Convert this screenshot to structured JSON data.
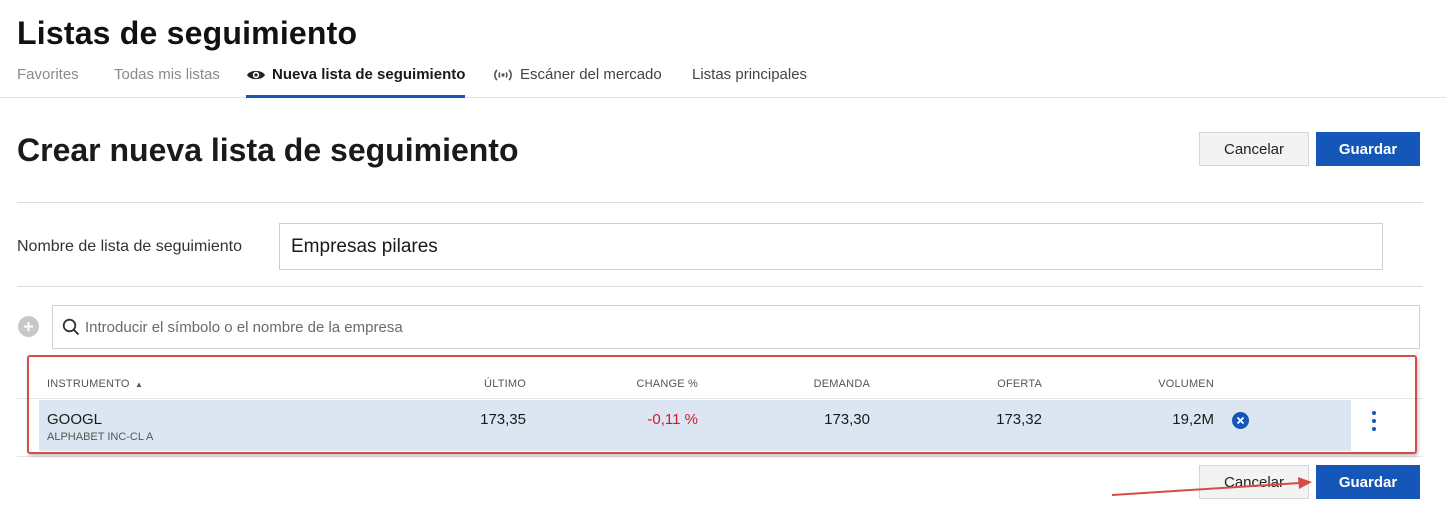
{
  "header": {
    "title": "Listas de seguimiento"
  },
  "tabs": [
    {
      "label": "Favorites"
    },
    {
      "label": "Todas mis listas"
    },
    {
      "label": "Nueva lista de seguimiento",
      "icon": "eye-icon"
    },
    {
      "label": "Escáner del mercado",
      "icon": "radar-icon"
    },
    {
      "label": "Listas principales"
    }
  ],
  "form": {
    "title": "Crear nueva lista de seguimiento",
    "cancel_label": "Cancelar",
    "save_label": "Guardar",
    "name_label": "Nombre de lista de seguimiento",
    "name_value": "Empresas pilares",
    "search_placeholder": "Introducir el símbolo o el nombre de la empresa"
  },
  "table": {
    "columns": [
      "INSTRUMENTO",
      "ÚLTIMO",
      "CHANGE %",
      "DEMANDA",
      "OFERTA",
      "VOLUMEN"
    ],
    "sort_indicator": "▲",
    "rows": [
      {
        "symbol": "GOOGL",
        "name": "ALPHABET INC-CL A",
        "last": "173,35",
        "change": "-0,11 %",
        "bid": "173,30",
        "ask": "173,32",
        "volume": "19,2M"
      }
    ]
  },
  "colors": {
    "accent": "#1457b8",
    "negative": "#d01a2c",
    "annotation": "#d94a4a",
    "row_selected": "#dce6f2"
  }
}
